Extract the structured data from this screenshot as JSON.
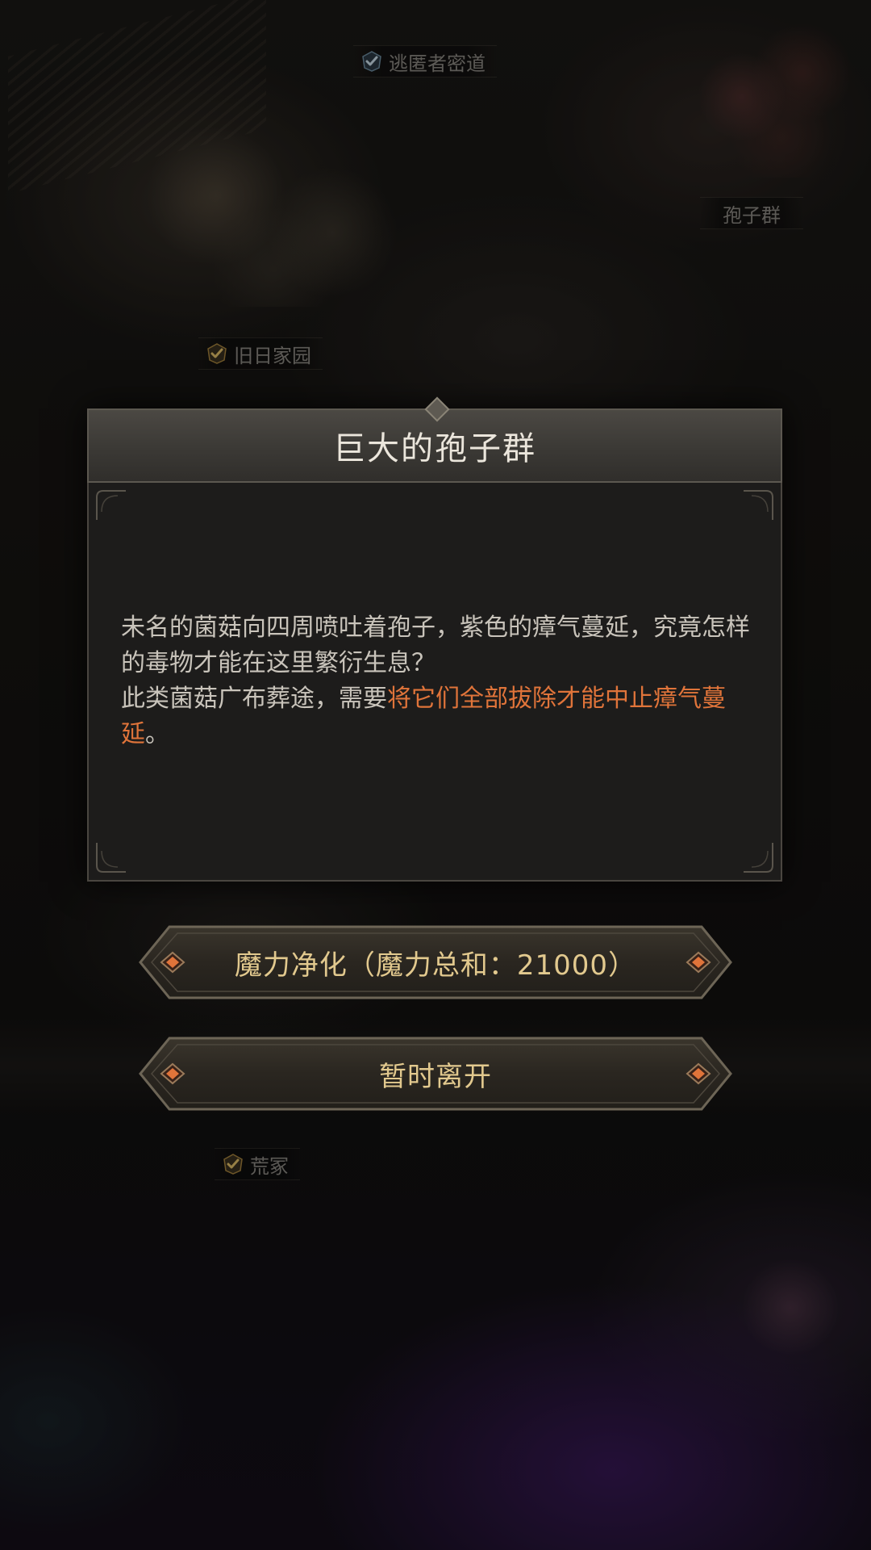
{
  "map": {
    "labels": {
      "escape_tunnel": "逃匿者密道",
      "spore_cluster": "孢子群",
      "old_home": "旧日家园",
      "wild_grave": "荒冢"
    }
  },
  "dialog": {
    "title": "巨大的孢子群",
    "body_line1": "未名的菌菇向四周喷吐着孢子，紫色的瘴气蔓延，究竟怎样的毒物才能在这里繁衍生息？",
    "body_line2_prefix": "此类菌菇广布葬途，需要",
    "body_line2_highlight": "将它们全部拔除才能中止瘴气蔓延",
    "body_line2_suffix": "。"
  },
  "buttons": {
    "purify_label": "魔力净化（魔力总和：21000）",
    "leave_label": "暂时离开"
  },
  "colors": {
    "highlight": "#e0743a",
    "button_text": "#e2c98e",
    "check_gold": "#c9a24a",
    "check_blue": "#8fb3c9"
  },
  "icons": {
    "visited_check": "check-badge-icon",
    "button_gem": "diamond-gem-icon"
  }
}
